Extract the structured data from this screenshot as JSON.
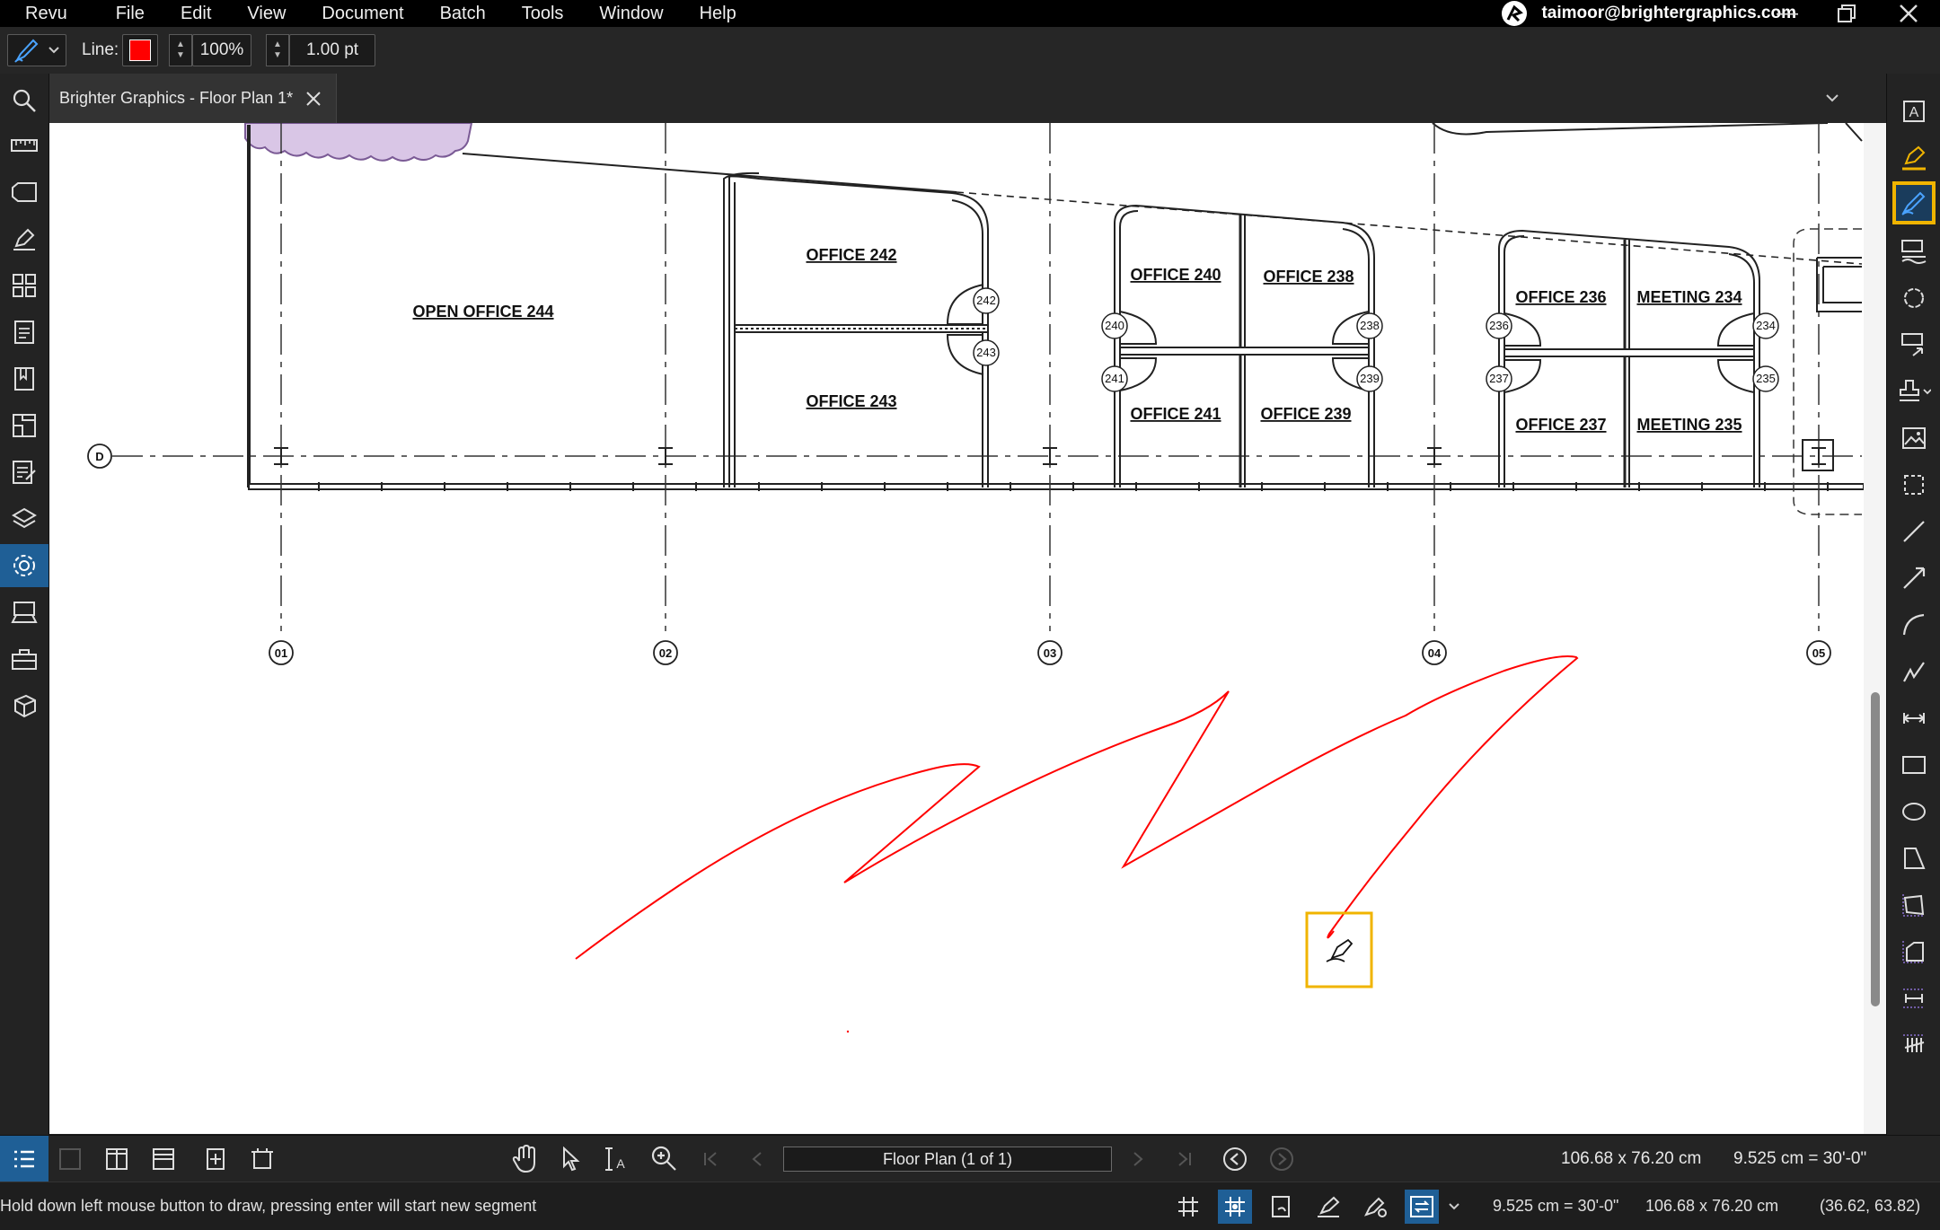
{
  "menu": {
    "items": [
      "Revu",
      "File",
      "Edit",
      "View",
      "Document",
      "Batch",
      "Tools",
      "Window",
      "Help"
    ],
    "account_email": "taimoor@brightergraphics.com"
  },
  "toolbar": {
    "line_label": "Line:",
    "line_color": "#ff0000",
    "opacity_value": "100%",
    "thickness_value": "1.00 pt"
  },
  "tabs": {
    "document_title": "Brighter Graphics - Floor Plan 1*"
  },
  "plan": {
    "rooms": {
      "open_office_244": "OPEN OFFICE  244",
      "office_242": "OFFICE  242",
      "office_243": "OFFICE  243",
      "office_240": "OFFICE  240",
      "office_238": "OFFICE  238",
      "office_241": "OFFICE  241",
      "office_239": "OFFICE  239",
      "office_236": "OFFICE  236",
      "meeting_234": "MEETING  234",
      "office_237": "OFFICE  237",
      "meeting_235": "MEETING  235"
    },
    "door_tags": {
      "d242": "242",
      "d243": "243",
      "d240": "240",
      "d241": "241",
      "d238": "238",
      "d239": "239",
      "d236": "236",
      "d237": "237",
      "d234": "234",
      "d235": "235"
    },
    "grid_lines": {
      "row_d": "D",
      "col_01": "01",
      "col_02": "02",
      "col_03": "03",
      "col_04": "04",
      "col_05": "05"
    },
    "markup_color": "#ff0000"
  },
  "bottom": {
    "page_label": "Floor Plan (1 of 1)",
    "page_size": "106.68 x 76.20 cm",
    "scale": "9.525 cm = 30'-0\""
  },
  "status": {
    "hint": "Hold down left mouse button to draw, pressing enter will start new segment",
    "scale": "9.525 cm = 30'-0\"",
    "page_size": "106.68 x 76.20 cm",
    "cursor_coords": "(36.62, 63.82)"
  },
  "colors": {
    "accent_blue": "#1f5f96",
    "highlight_yellow": "#f0b400",
    "cloud_fill": "#d9c6e6"
  }
}
